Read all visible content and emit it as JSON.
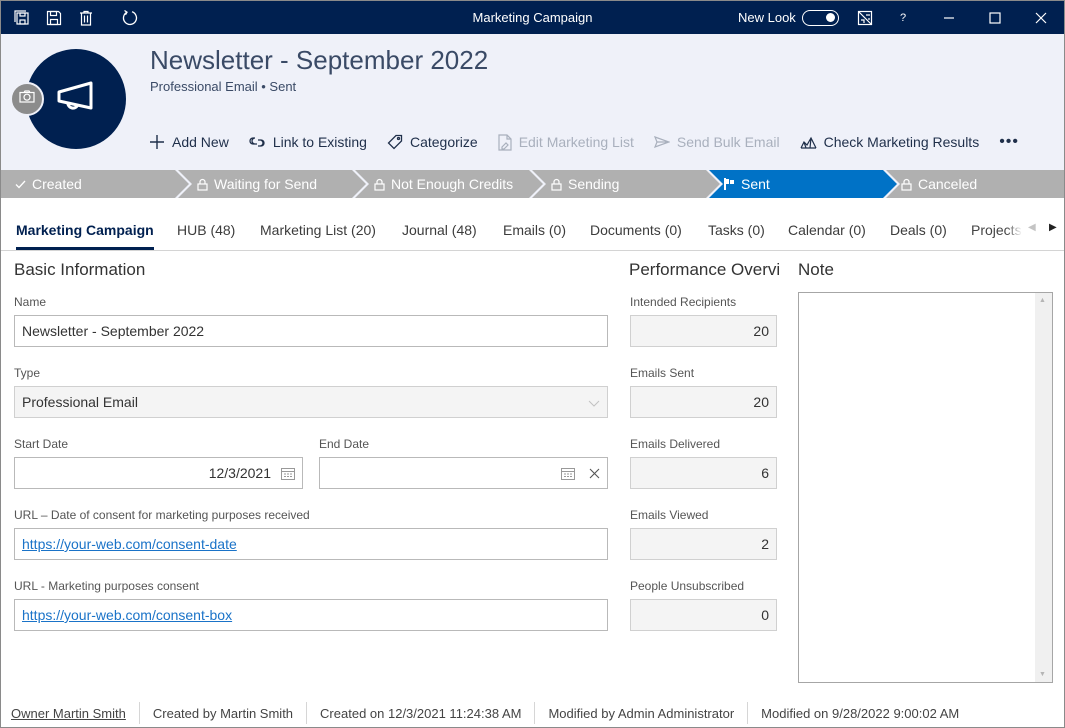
{
  "window": {
    "title": "Marketing Campaign",
    "new_look_label": "New Look",
    "new_look_enabled": true,
    "help_label": "?",
    "colors": {
      "titlebar": "#002050",
      "header_bg": "#eff1f9",
      "stage_inactive": "#b0b0b0",
      "stage_active": "#0072c6",
      "link": "#1a73c8"
    }
  },
  "toolbar": {
    "icons": [
      "save-and-close-icon",
      "save-icon",
      "delete-icon",
      "refresh-icon"
    ]
  },
  "record": {
    "title": "Newsletter - September 2022",
    "subtitle": "Professional Email • Sent",
    "avatar_icon": "megaphone-icon"
  },
  "actions": [
    {
      "label": "Add New",
      "icon": "plus-icon",
      "enabled": true
    },
    {
      "label": "Link to Existing",
      "icon": "link-icon",
      "enabled": true
    },
    {
      "label": "Categorize",
      "icon": "tag-icon",
      "enabled": true
    },
    {
      "label": "Edit Marketing List",
      "icon": "document-edit-icon",
      "enabled": false
    },
    {
      "label": "Send Bulk Email",
      "icon": "send-icon",
      "enabled": false
    },
    {
      "label": "Check Marketing Results",
      "icon": "chart-icon",
      "enabled": true
    }
  ],
  "more_label": "•••",
  "stages": [
    {
      "label": "Created",
      "icon": "check-icon",
      "state": "done"
    },
    {
      "label": "Waiting for Send",
      "icon": "lock-icon",
      "state": "locked"
    },
    {
      "label": "Not Enough Credits",
      "icon": "lock-icon",
      "state": "locked"
    },
    {
      "label": "Sending",
      "icon": "lock-icon",
      "state": "locked"
    },
    {
      "label": "Sent",
      "icon": "flag-icon",
      "state": "active"
    },
    {
      "label": "Canceled",
      "icon": "lock-icon",
      "state": "locked"
    }
  ],
  "tabs": [
    {
      "label": "Marketing Campaign",
      "active": true
    },
    {
      "label": "HUB (48)"
    },
    {
      "label": "Marketing List (20)"
    },
    {
      "label": "Journal (48)"
    },
    {
      "label": "Emails (0)"
    },
    {
      "label": "Documents (0)"
    },
    {
      "label": "Tasks (0)"
    },
    {
      "label": "Calendar (0)"
    },
    {
      "label": "Deals (0)"
    },
    {
      "label": "Projects"
    }
  ],
  "basic_info": {
    "title": "Basic Information",
    "name_label": "Name",
    "name_value": "Newsletter - September 2022",
    "type_label": "Type",
    "type_value": "Professional Email",
    "start_date_label": "Start Date",
    "start_date_value": "12/3/2021",
    "end_date_label": "End Date",
    "end_date_value": "",
    "url_consent_date_label": "URL – Date of consent for marketing purposes received",
    "url_consent_date_value": "https://your-web.com/consent-date",
    "url_consent_label": "URL - Marketing purposes consent",
    "url_consent_value": "https://your-web.com/consent-box"
  },
  "performance": {
    "title": "Performance Overvi",
    "fields": [
      {
        "label": "Intended Recipients",
        "value": "20"
      },
      {
        "label": "Emails Sent",
        "value": "20"
      },
      {
        "label": "Emails Delivered",
        "value": "6"
      },
      {
        "label": "Emails Viewed",
        "value": "2"
      },
      {
        "label": "People Unsubscribed",
        "value": "0"
      }
    ]
  },
  "note": {
    "title": "Note",
    "value": ""
  },
  "footer": {
    "owner": "Owner Martin Smith",
    "created_by": "Created by Martin Smith",
    "created_on": "Created on 12/3/2021 11:24:38 AM",
    "modified_by": "Modified by Admin Administrator",
    "modified_on": "Modified on 9/28/2022 9:00:02 AM"
  }
}
